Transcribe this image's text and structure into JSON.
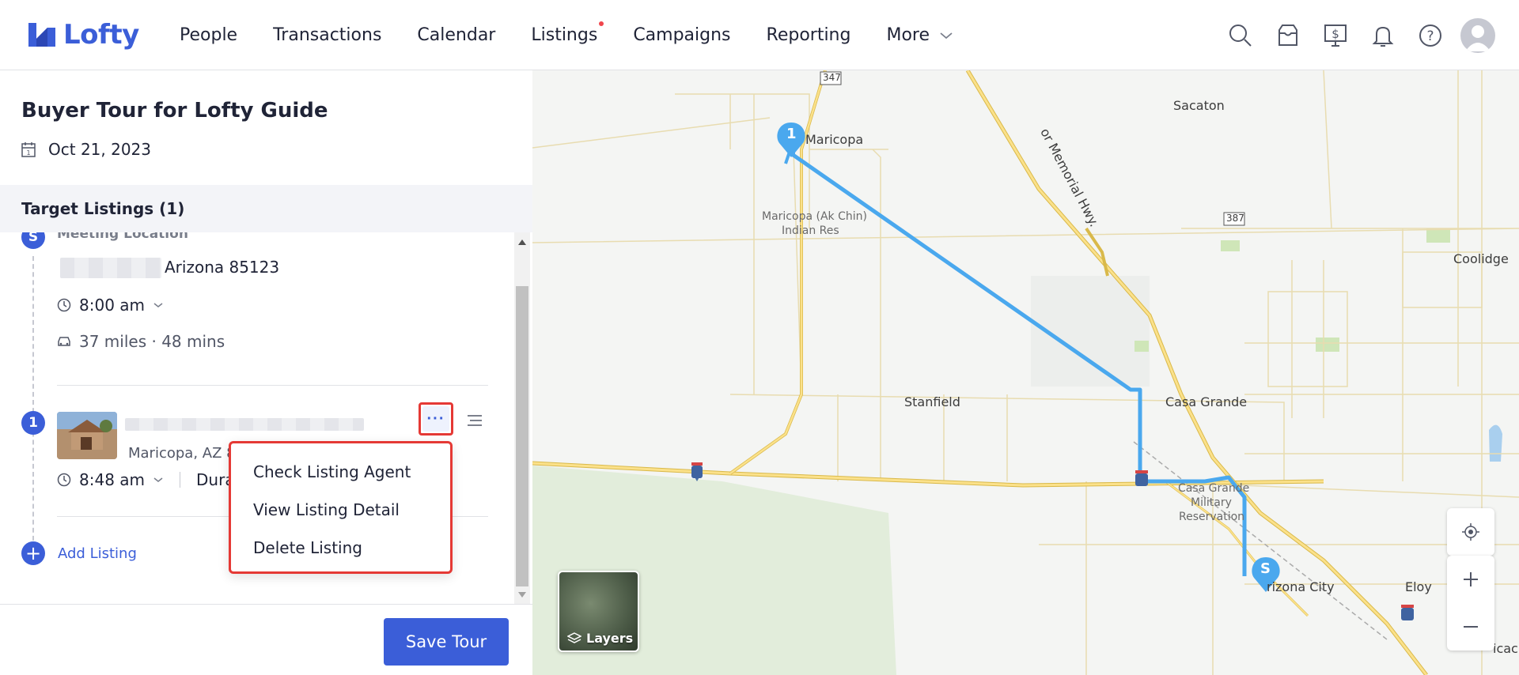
{
  "app": {
    "name": "Lofty",
    "brand_color": "#3b5ed8"
  },
  "nav": {
    "items": [
      {
        "label": "People"
      },
      {
        "label": "Transactions"
      },
      {
        "label": "Calendar"
      },
      {
        "label": "Listings",
        "has_dot": true
      },
      {
        "label": "Campaigns"
      },
      {
        "label": "Reporting"
      }
    ],
    "more_label": "More",
    "icons": [
      "search-icon",
      "inbox-icon",
      "billing-icon",
      "bell-icon",
      "help-icon"
    ]
  },
  "tour": {
    "title": "Buyer Tour for Lofty Guide",
    "date": "Oct 21, 2023",
    "section_title": "Target Listings (1)",
    "meeting": {
      "badge": "S",
      "label": "Meeting Location",
      "address_visible": "Arizona 85123",
      "time": "8:00 am",
      "travel": "37 miles · 48 mins"
    },
    "listing": {
      "badge": "1",
      "city": "Maricopa, AZ 8",
      "time": "8:48 am",
      "duration_label": "Durat"
    },
    "add_listing_label": "Add Listing",
    "save_label": "Save Tour"
  },
  "dropdown": {
    "items": [
      "Check Listing Agent",
      "View Listing Detail",
      "Delete Listing"
    ]
  },
  "map": {
    "labels": {
      "maricopa": "Maricopa",
      "ak_chin_1": "Maricopa (Ak Chin)",
      "ak_chin_2": "Indian Res",
      "sacaton": "Sacaton",
      "memorial_hwy": "or Memorial Hwy.",
      "coolidge": "Coolidge",
      "stanfield": "Stanfield",
      "casa_grande": "Casa Grande",
      "military_1": "Casa Grande",
      "military_2": "Military",
      "military_3": "Reservation",
      "arizona_city": "rizona City",
      "eloy": "Eloy",
      "picacho": "icach",
      "hwy_347": "347",
      "hwy_387": "387"
    },
    "pin_start": "S",
    "pin_one": "1",
    "layers_label": "Layers",
    "route_color": "#4aa8ee"
  }
}
